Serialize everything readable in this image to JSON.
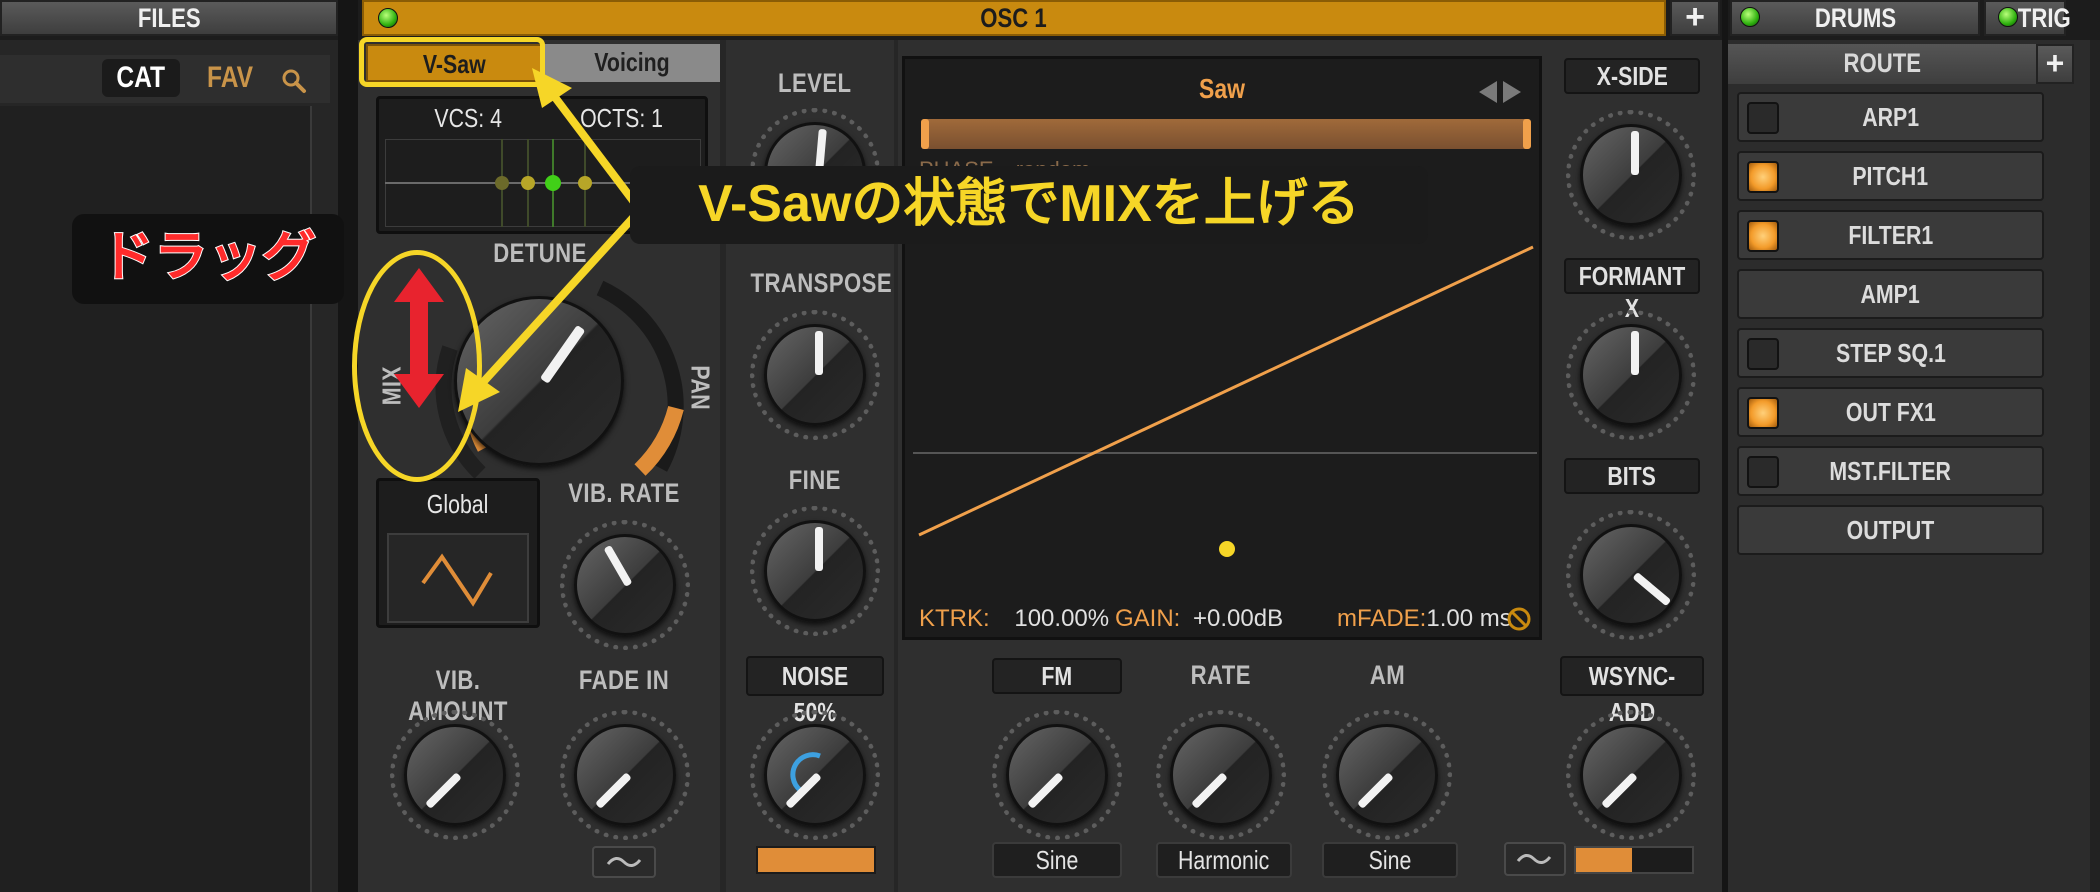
{
  "files_header": "FILES",
  "browser": {
    "cat": "CAT",
    "fav": "FAV"
  },
  "osc": {
    "title": "OSC 1",
    "add": "+"
  },
  "drums": {
    "title": "DRUMS",
    "trig": "TRIG"
  },
  "tabs": {
    "vsaw": "V-Saw",
    "voicing": "Voicing"
  },
  "unison": {
    "vcs": "VCS: 4",
    "octs": "OCTS: 1"
  },
  "knobs": {
    "detune": "DETUNE",
    "mix": "MIX",
    "pan": "PAN",
    "level": "LEVEL",
    "transpose": "TRANSPOSE",
    "fine": "FINE",
    "vib_rate": "VIB. RATE",
    "vib_amount": "VIB. AMOUNT",
    "fade_in": "FADE IN",
    "noise": "NOISE 50%",
    "fm": "FM",
    "rate": "RATE",
    "am": "AM",
    "xside": "X-SIDE",
    "formant": "FORMANT X",
    "bits": "BITS",
    "wsync": "WSYNC-ADD"
  },
  "global_lfo": "Global",
  "waveform": {
    "name": "Saw",
    "phase": "PHASE",
    "phase_value": "random",
    "ktrk_label": "KTRK:",
    "ktrk_value": "100.00%",
    "gain_label": "GAIN:",
    "gain_value": "+0.00dB",
    "mfade_label": "mFADE:",
    "mfade_value": "1.00 ms"
  },
  "mod_shapes": {
    "fm": "Sine",
    "rate": "Harmonic",
    "am": "Sine"
  },
  "route": {
    "title": "ROUTE",
    "add": "+",
    "items": [
      {
        "label": "ARP1",
        "active": false
      },
      {
        "label": "PITCH1",
        "active": true
      },
      {
        "label": "FILTER1",
        "active": true
      },
      {
        "label": "AMP1",
        "active": null
      },
      {
        "label": "STEP SQ.1",
        "active": false
      },
      {
        "label": "OUT FX1",
        "active": true
      },
      {
        "label": "MST.FILTER",
        "active": false
      },
      {
        "label": "OUTPUT",
        "active": null
      }
    ]
  },
  "annotations": {
    "drag": "ドラッグ",
    "instruction": "V-Sawの状態でMIXを上げる"
  },
  "colors": {
    "accent": "#f0a04b",
    "highlight": "#f6d627",
    "led_green": "#3bd118",
    "drag_red": "#e8232e"
  }
}
